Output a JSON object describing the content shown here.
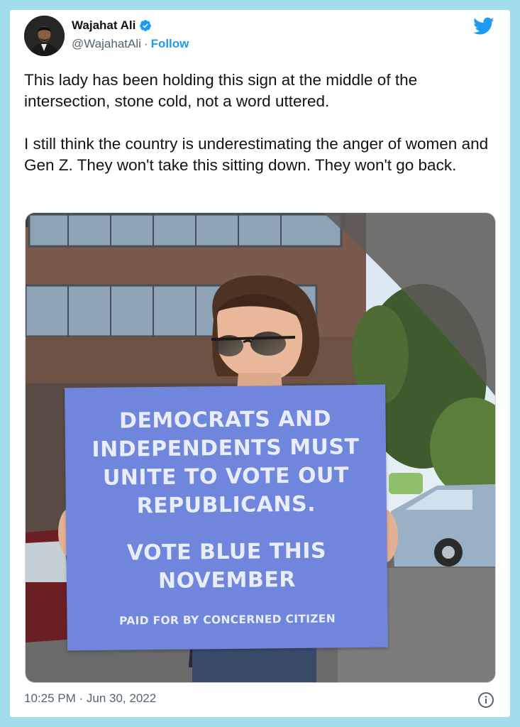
{
  "author": {
    "name": "Wajahat Ali",
    "handle": "@WajahatAli",
    "separator": "·",
    "follow_label": "Follow"
  },
  "icons": {
    "verified": "verified-badge-icon",
    "brand": "twitter-bird-icon",
    "info": "info-icon"
  },
  "tweet": {
    "paragraph_1": "This lady has been holding this sign at the middle of the intersection, stone cold, not a word uttered.",
    "paragraph_2": "I still think the country is underestimating the anger of women and Gen Z. They won't take this sitting down. They won't go back."
  },
  "photo": {
    "sign_line_1": "DEMOCRATS AND INDEPENDENTS MUST UNITE TO VOTE OUT REPUBLICANS.",
    "sign_line_2": "VOTE BLUE THIS NOVEMBER",
    "sign_line_3": "PAID FOR BY CONCERNED CITIZEN"
  },
  "timestamp": "10:25 PM · Jun 30, 2022",
  "colors": {
    "accent": "#1d9bf0",
    "frame": "#a3dceb",
    "sign": "#6f86dc"
  }
}
